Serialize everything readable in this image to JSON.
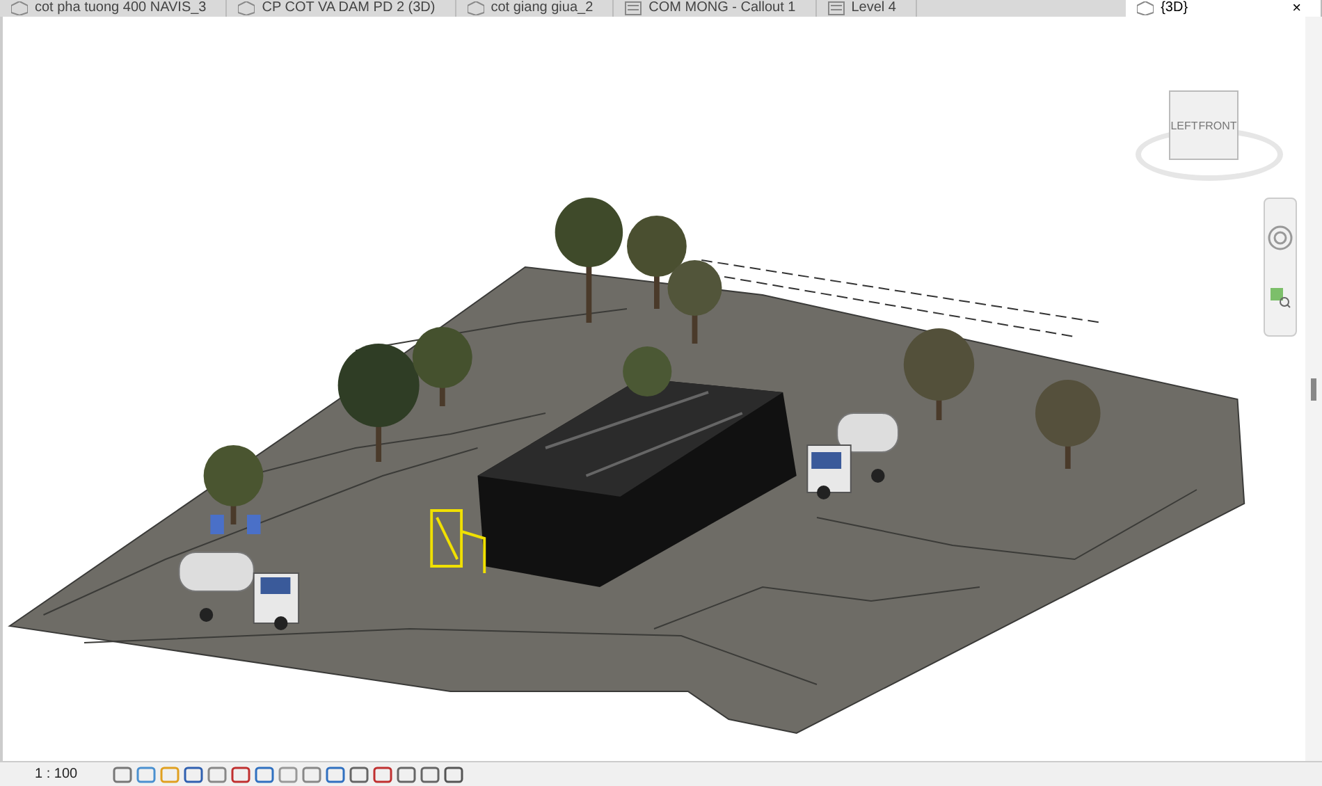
{
  "tabs": [
    {
      "label": "cot pha tuong 400  NAVIS_3",
      "kind": "model",
      "selected": false
    },
    {
      "label": "CP COT VA DAM PD 2 (3D)",
      "kind": "model",
      "selected": false
    },
    {
      "label": "cot giang giua_2",
      "kind": "model",
      "selected": false
    },
    {
      "label": "COM MONG - Callout 1",
      "kind": "plan",
      "selected": false
    },
    {
      "label": "Level 4",
      "kind": "plan",
      "selected": false
    },
    {
      "label": "{3D}",
      "kind": "model",
      "selected": true,
      "close": "×"
    }
  ],
  "view_cube": {
    "faces": [
      "LEFT",
      "FRONT"
    ]
  },
  "status_bar": {
    "scale": "1 : 100"
  }
}
